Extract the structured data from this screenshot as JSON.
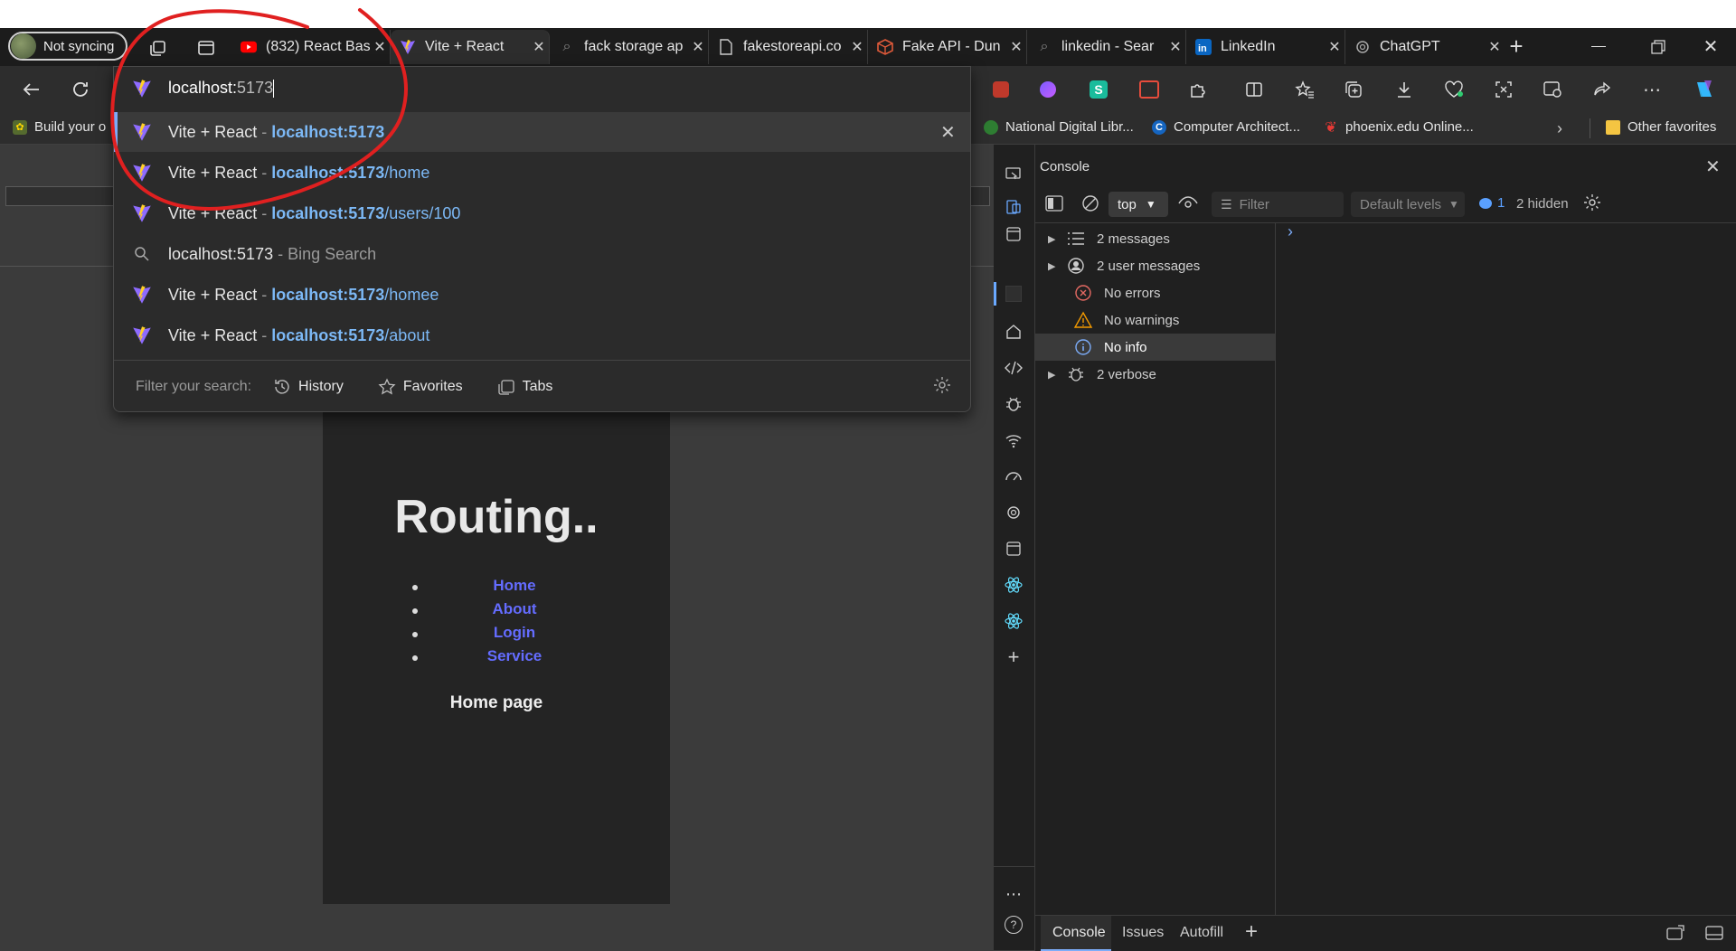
{
  "profile": {
    "label": "Not syncing"
  },
  "tabs": [
    {
      "title": "(832) React Bas",
      "icon": "youtube-icon"
    },
    {
      "title": "Vite + React",
      "icon": "vite-icon"
    },
    {
      "title": "fack storage ap",
      "icon": "search-icon"
    },
    {
      "title": "fakestoreapi.co",
      "icon": "page-icon"
    },
    {
      "title": "Fake API - Dun",
      "icon": "box-icon"
    },
    {
      "title": "linkedin - Sear",
      "icon": "search-icon"
    },
    {
      "title": "LinkedIn",
      "icon": "linkedin-icon"
    },
    {
      "title": "ChatGPT",
      "icon": "chatgpt-icon"
    }
  ],
  "addressbar": {
    "typed": "localhost:",
    "completion": "5173"
  },
  "suggestions": [
    {
      "title": "Vite + React",
      "sep": " - ",
      "host": "localhost:5173",
      "path": "",
      "icon": "vite-icon",
      "highlighted": true
    },
    {
      "title": "Vite + React",
      "sep": " - ",
      "host": "localhost:5173",
      "path": "/home",
      "icon": "vite-icon"
    },
    {
      "title": "Vite + React",
      "sep": " - ",
      "host": "localhost:5173",
      "path": "/users/100",
      "icon": "vite-icon"
    },
    {
      "title": "localhost:5173",
      "sep": " - ",
      "host": "",
      "path": "Bing Search",
      "icon": "search-icon"
    },
    {
      "title": "Vite + React",
      "sep": " - ",
      "host": "localhost:5173",
      "path": "/homee",
      "icon": "vite-icon"
    },
    {
      "title": "Vite + React",
      "sep": " - ",
      "host": "localhost:5173",
      "path": "/about",
      "icon": "vite-icon"
    }
  ],
  "filter": {
    "label": "Filter your search:",
    "history": "History",
    "favorites": "Favorites",
    "tabs": "Tabs"
  },
  "favorites": {
    "left": "Build your o",
    "items": [
      "National Digital Libr...",
      "Computer Architect...",
      "phoenix.edu Online..."
    ],
    "other": "Other favorites"
  },
  "page": {
    "title": "Routing..",
    "links": [
      "Home",
      "About",
      "Login",
      "Service"
    ],
    "footer": "Home page",
    "link_color": "#646cff"
  },
  "devtools": {
    "panel_title": "Console",
    "context": "top",
    "filter_placeholder": "Filter",
    "levels": "Default levels",
    "issues_count": "1",
    "hidden": "2 hidden",
    "sidebar": [
      {
        "label": "2 messages",
        "expandable": true
      },
      {
        "label": "2 user messages",
        "expandable": true
      },
      {
        "label": "No errors",
        "expandable": false
      },
      {
        "label": "No warnings",
        "expandable": false
      },
      {
        "label": "No info",
        "expandable": false,
        "selected": true
      },
      {
        "label": "2 verbose",
        "expandable": true
      }
    ],
    "bottom_tabs": [
      "Console",
      "Issues",
      "Autofill"
    ]
  }
}
